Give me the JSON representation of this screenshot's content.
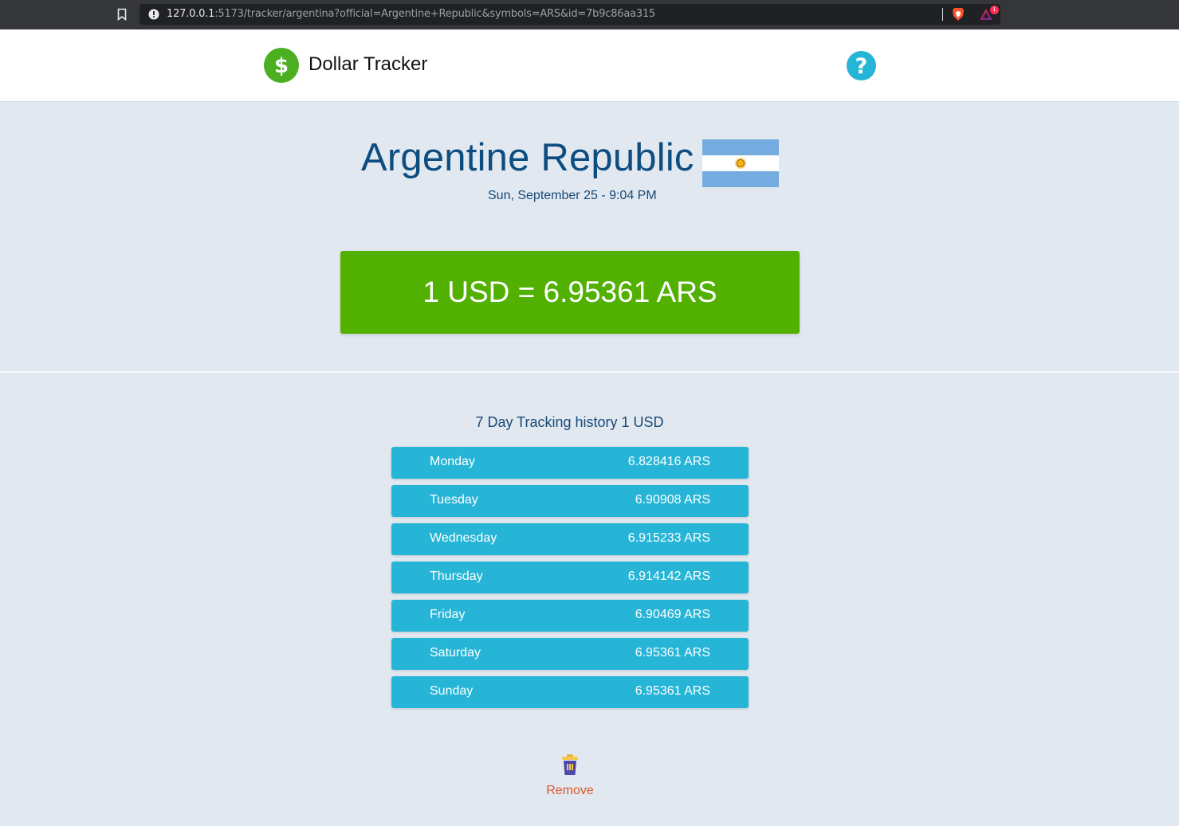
{
  "browser": {
    "url_host": "127.0.0.1",
    "url_rest": ":5173/tracker/argentina?official=Argentine+Republic&symbols=ARS&id=7b9c86aa315",
    "rewards_badge": "1"
  },
  "header": {
    "brand": "Dollar Tracker",
    "logo_symbol": "$",
    "help_symbol": "?"
  },
  "country": {
    "name": "Argentine Republic",
    "datetime": "Sun, September 25 - 9:04 PM",
    "flag_colors": [
      "#74acdf",
      "#ffffff",
      "#74acdf"
    ],
    "sun_color": "#f6b40e"
  },
  "rate": {
    "text": "1 USD = 6.95361 ARS"
  },
  "history": {
    "title": "7 Day Tracking history 1 USD",
    "rows": [
      {
        "day": "Monday",
        "value": "6.828416 ARS"
      },
      {
        "day": "Tuesday",
        "value": "6.90908 ARS"
      },
      {
        "day": "Wednesday",
        "value": "6.915233 ARS"
      },
      {
        "day": "Thursday",
        "value": "6.914142 ARS"
      },
      {
        "day": "Friday",
        "value": "6.90469 ARS"
      },
      {
        "day": "Saturday",
        "value": "6.95361 ARS"
      },
      {
        "day": "Sunday",
        "value": "6.95361 ARS"
      }
    ]
  },
  "actions": {
    "remove_label": "Remove"
  },
  "colors": {
    "accent_green": "#52b000",
    "accent_cyan": "#26b5d6",
    "title_blue": "#0e4d80",
    "remove_orange": "#e0562c"
  }
}
